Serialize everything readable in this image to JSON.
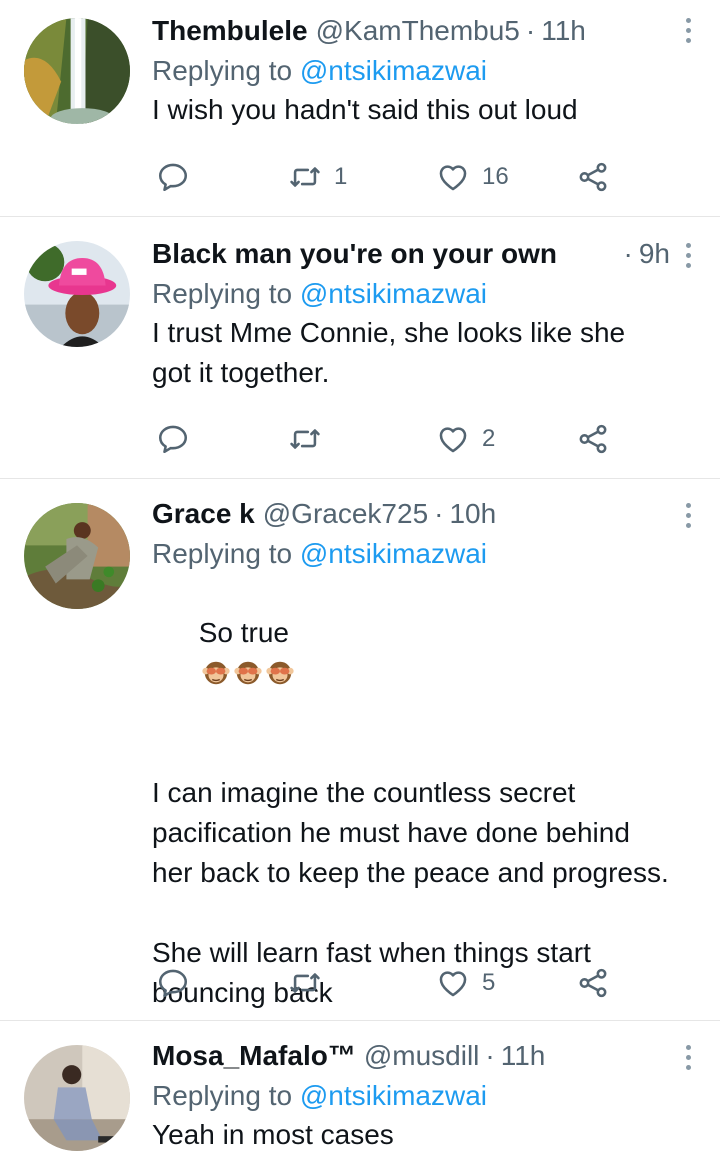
{
  "tweets": [
    {
      "name": "Thembulele",
      "handle": "@KamThembu5",
      "dot": "·",
      "time": "11h",
      "replying_prefix": "Replying to",
      "replying_to": "@ntsikimazwai",
      "text": "I wish you hadn't said this out loud",
      "retweets": "1",
      "likes": "16",
      "avatar_icon": "waterfall-avatar"
    },
    {
      "name": "Black man you're on your own",
      "handle": "",
      "dot": "·",
      "time": "9h",
      "replying_prefix": "Replying to",
      "replying_to": "@ntsikimazwai",
      "text": "I trust Mme Connie, she looks like she got it together.",
      "retweets": "",
      "likes": "2",
      "avatar_icon": "pink-hat-avatar"
    },
    {
      "name": "Grace k",
      "handle": "@Gracek725",
      "dot": "·",
      "time": "10h",
      "replying_prefix": "Replying to",
      "replying_to": "@ntsikimazwai",
      "text_first": "So true",
      "text": "I can imagine the countless secret pacification he must have done behind her back to keep the peace and progress.\n\nShe will learn fast when things start bouncing back",
      "emoji": "see-no-evil-monkey-icon",
      "retweets": "",
      "likes": "5",
      "avatar_icon": "garden-avatar"
    },
    {
      "name": "Mosa_Mafalo™",
      "handle": "@musdill",
      "dot": "·",
      "time": "11h",
      "replying_prefix": "Replying to",
      "replying_to": "@ntsikimazwai",
      "text": "Yeah in most cases",
      "avatar_icon": "suit-man-avatar"
    }
  ],
  "colors": {
    "text": "#0f1419",
    "secondary": "#536471",
    "link": "#1d9bf0",
    "divider": "#e6e6e6"
  }
}
